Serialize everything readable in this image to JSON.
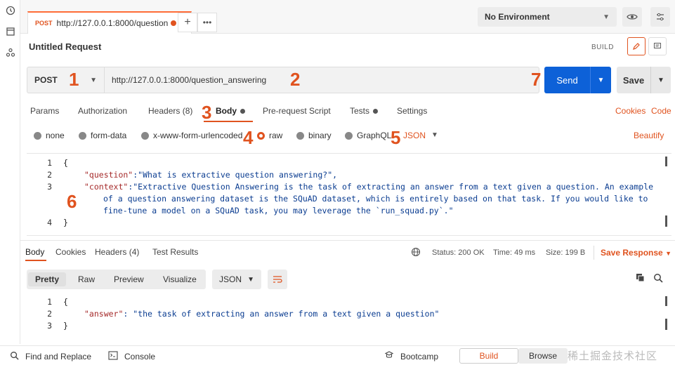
{
  "tab": {
    "method": "POST",
    "url": "http://127.0.0.1:8000/question..."
  },
  "environment": {
    "label": "No Environment"
  },
  "request": {
    "title": "Untitled Request",
    "build_label": "BUILD",
    "method": "POST",
    "url": "http://127.0.0.1:8000/question_answering",
    "send_label": "Send",
    "save_label": "Save"
  },
  "req_tabs": {
    "params": "Params",
    "authorization": "Authorization",
    "headers": "Headers (8)",
    "body": "Body",
    "prerequest": "Pre-request Script",
    "tests": "Tests",
    "settings": "Settings",
    "cookies": "Cookies",
    "code": "Code"
  },
  "body_types": {
    "none": "none",
    "form_data": "form-data",
    "urlencoded": "x-www-form-urlencoded",
    "raw": "raw",
    "binary": "binary",
    "graphql": "GraphQL",
    "format": "JSON",
    "beautify": "Beautify"
  },
  "request_body": {
    "line_numbers": [
      "1",
      "2",
      "3",
      "",
      "",
      "4"
    ],
    "l1": "{",
    "l2_key": "\"question\"",
    "l2_val": ":\"What is extractive question answering?\",",
    "l3_key": "\"context\"",
    "l3_val": ":\"Extractive Question Answering is the task of extracting an answer from a text given a question. An example",
    "l3_wrap1": "of a question answering dataset is the SQuAD dataset, which is entirely based on that task. If you would like to",
    "l3_wrap2": "fine-tune a model on a SQuAD task, you may leverage the `run_squad.py`.\"",
    "l4": "}"
  },
  "resp_tabs": {
    "body": "Body",
    "cookies": "Cookies",
    "headers": "Headers (4)",
    "tests": "Test Results"
  },
  "response_status": {
    "status": "Status: 200 OK",
    "time": "Time: 49 ms",
    "size": "Size: 199 B",
    "save_response": "Save Response"
  },
  "resp_view": {
    "pretty": "Pretty",
    "raw": "Raw",
    "preview": "Preview",
    "visualize": "Visualize",
    "format": "JSON"
  },
  "response_body": {
    "ln1": "1",
    "ln2": "2",
    "ln3": "3",
    "l1": "{",
    "l2_key": "\"answer\"",
    "l2_val": ": \"the task of extracting an answer from a text given a question\"",
    "l3": "}"
  },
  "footer": {
    "find_replace": "Find and Replace",
    "console": "Console",
    "bootcamp": "Bootcamp",
    "build": "Build",
    "browse": "Browse"
  },
  "annotations": [
    "1",
    "2",
    "3",
    "4",
    "5",
    "6",
    "7"
  ],
  "watermark": "稀土掘金技术社区",
  "colors": {
    "accent": "#e0531f",
    "send": "#0d61d8"
  }
}
